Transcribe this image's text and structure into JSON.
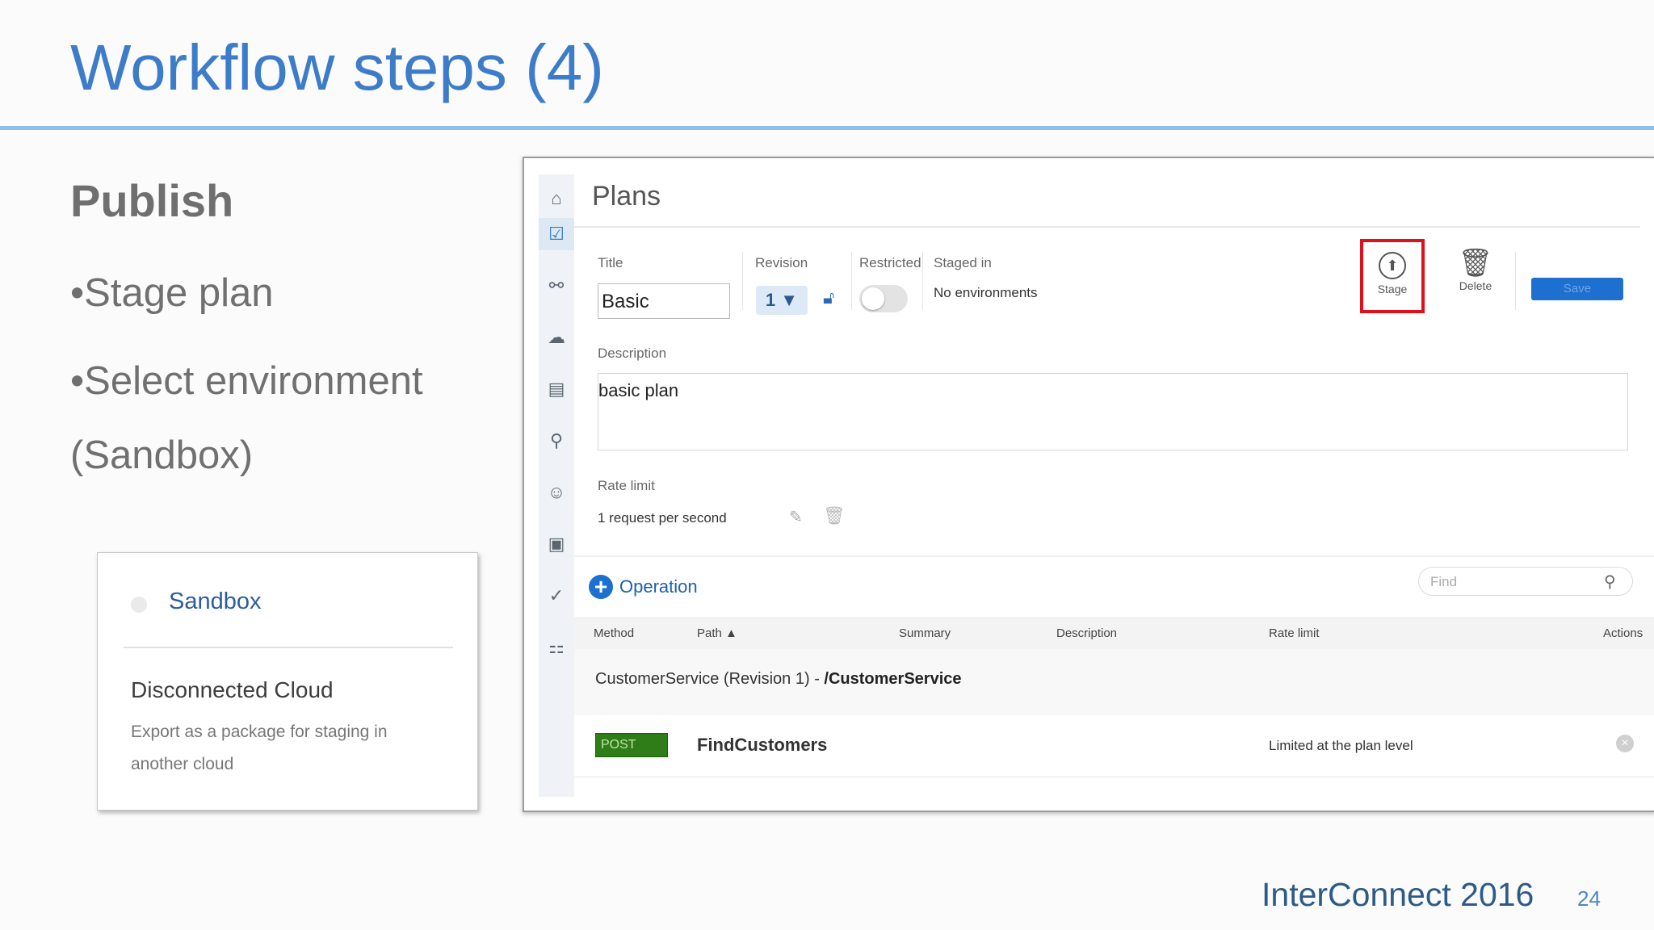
{
  "slide": {
    "title": "Workflow steps (4)",
    "section": "Publish",
    "bullets": [
      "•Stage plan",
      "•Select environment",
      "(Sandbox)"
    ],
    "footer": "InterConnect 2016",
    "page_number": "24"
  },
  "environment_card": {
    "selected_option": "Sandbox",
    "cloud_title": "Disconnected Cloud",
    "cloud_desc_line1": "Export as a package for staging in",
    "cloud_desc_line2": "another cloud"
  },
  "app": {
    "header": "Plans",
    "sidebar_icons": [
      "home-icon",
      "plans-icon",
      "share-icon",
      "cloud-icon",
      "docs-icon",
      "analytics-icon",
      "users-icon",
      "profile-icon",
      "approvals-icon",
      "apps-icon"
    ],
    "form": {
      "title_label": "Title",
      "title_value": "Basic",
      "revision_label": "Revision",
      "revision_value": "1",
      "restricted_label": "Restricted",
      "staged_in_label": "Staged in",
      "staged_in_value": "No environments",
      "stage_button": "Stage",
      "delete_button": "Delete",
      "save_button": "Save",
      "description_label": "Description",
      "description_value": "basic plan",
      "rate_limit_label": "Rate limit",
      "rate_limit_value": "1 request per second"
    },
    "operations": {
      "add_label": "Operation",
      "search_placeholder": "Find",
      "columns": [
        "Method",
        "Path ▲",
        "Summary",
        "Description",
        "Rate limit",
        "Actions"
      ],
      "group_prefix": "CustomerService (Revision 1) - ",
      "group_path": "/CustomerService",
      "rows": [
        {
          "method": "POST",
          "name": "FindCustomers",
          "rate_limit": "Limited at the plan level"
        }
      ]
    }
  },
  "colors": {
    "title_blue": "#3d7cc9",
    "accent_rule": "#8ec0ea",
    "primary_button": "#1d6fd0",
    "highlight_red": "#e0101a",
    "post_green": "#2f7d19"
  }
}
